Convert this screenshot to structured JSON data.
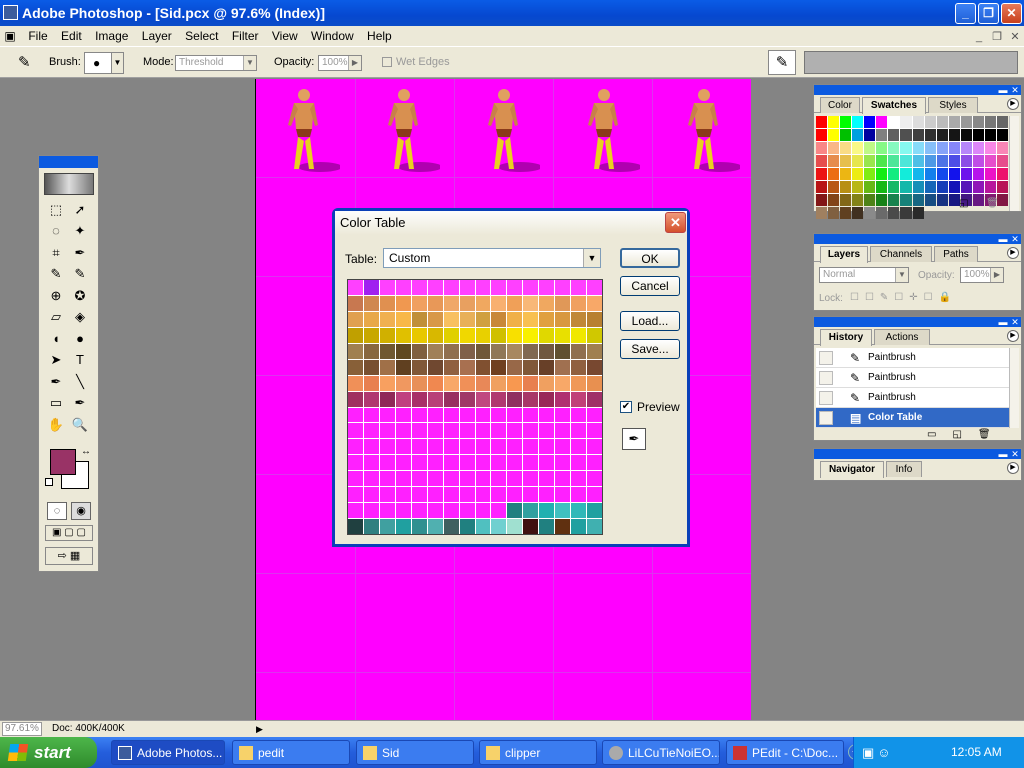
{
  "window": {
    "title": "Adobe Photoshop - [Sid.pcx @ 97.6% (Index)]"
  },
  "menubar": [
    "File",
    "Edit",
    "Image",
    "Layer",
    "Select",
    "Filter",
    "View",
    "Window",
    "Help"
  ],
  "options": {
    "brush_label": "Brush:",
    "mode_label": "Mode:",
    "mode_value": "Threshold",
    "opacity_label": "Opacity:",
    "opacity_value": "100%",
    "wet_edges": "Wet Edges"
  },
  "swatches_panel": {
    "tabs": [
      "Color",
      "Swatches",
      "Styles"
    ],
    "active": "Swatches"
  },
  "layers_panel": {
    "tabs": [
      "Layers",
      "Channels",
      "Paths"
    ],
    "active": "Layers",
    "blend": "Normal",
    "opacity_label": "Opacity:",
    "opacity_value": "100%",
    "lock_label": "Lock:"
  },
  "history_panel": {
    "tabs": [
      "History",
      "Actions"
    ],
    "active": "History",
    "items": [
      "Paintbrush",
      "Paintbrush",
      "Paintbrush",
      "Color Table"
    ],
    "selected": "Color Table"
  },
  "navigator_panel": {
    "tabs": [
      "Navigator",
      "Info"
    ],
    "active": "Navigator"
  },
  "dialog": {
    "title": "Color Table",
    "table_label": "Table:",
    "table_value": "Custom",
    "ok": "OK",
    "cancel": "Cancel",
    "load": "Load...",
    "save": "Save...",
    "preview": "Preview",
    "preview_checked": true
  },
  "status": {
    "zoom": "97.61%",
    "doc": "Doc: 400K/400K"
  },
  "taskbar": {
    "start": "start",
    "tasks": [
      "Adobe Photos...",
      "pedit",
      "Sid",
      "clipper",
      "LiLCuTieNoiEO...",
      "PEdit - C:\\Doc..."
    ],
    "active": "Adobe Photos...",
    "clock": "12:05 AM"
  },
  "colors": {
    "canvas": "#ff00ff",
    "foreground": "#993366",
    "background": "#ffffff",
    "titlebar": "#0a5ce6"
  }
}
